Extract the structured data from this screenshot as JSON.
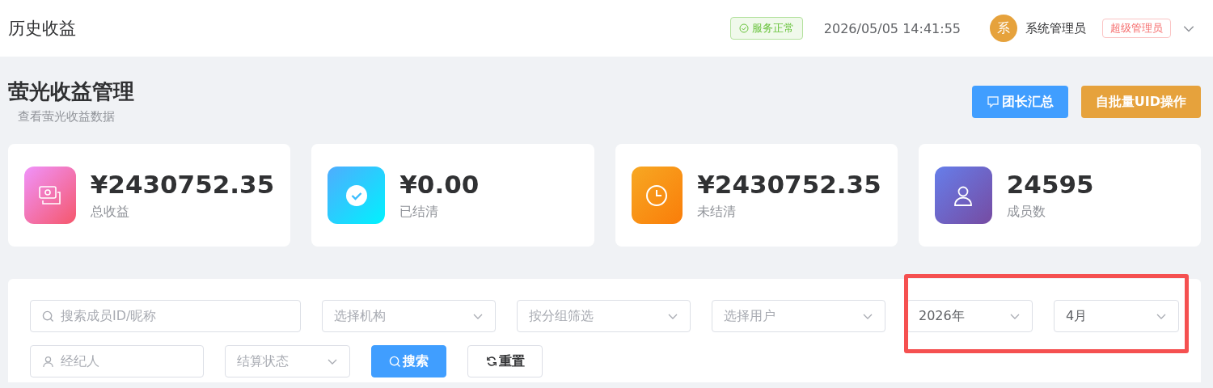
{
  "header": {
    "title": "历史收益",
    "status": {
      "label": "服务正常",
      "ok": true
    },
    "datetime": "2026/05/05 14:41:55",
    "user": {
      "avatar": "系",
      "name": "系统管理员",
      "role": "超级管理员"
    }
  },
  "page": {
    "title": "萤光收益管理",
    "subtitle": "查看萤光收益数据",
    "actions": [
      {
        "label": "团长汇总",
        "kind": "primary"
      },
      {
        "label": "自批量UID操作",
        "kind": "warning"
      }
    ]
  },
  "stats": [
    {
      "kind": "money",
      "value": "¥2430752.35",
      "label": "总收益"
    },
    {
      "kind": "check",
      "value": "¥0.00",
      "label": "已结清"
    },
    {
      "kind": "clock",
      "value": "¥2430752.35",
      "label": "未结清"
    },
    {
      "kind": "user",
      "value": "24595",
      "label": "成员数"
    }
  ],
  "filters": [
    [
      {
        "kind": "search",
        "placeholder": "搜索成员ID/昵称",
        "highlighted": false
      },
      {
        "kind": "select",
        "placeholder": "选择机构",
        "highlighted": false
      },
      {
        "kind": "select",
        "placeholder": "按分组筛选",
        "highlighted": false
      },
      {
        "kind": "select",
        "placeholder": "选择用户",
        "highlighted": false
      },
      {
        "kind": "select",
        "value": "2026年",
        "highlighted": true
      },
      {
        "kind": "select",
        "value": "4月",
        "highlighted": true
      }
    ],
    [
      {
        "kind": "person",
        "placeholder": "经纪人",
        "highlighted": false
      },
      {
        "kind": "select",
        "placeholder": "结算状态",
        "highlighted": false
      },
      {
        "kind": "search-button",
        "label": "搜索",
        "highlighted": false
      },
      {
        "kind": "reset-button",
        "label": "重置",
        "highlighted": false
      }
    ]
  ]
}
